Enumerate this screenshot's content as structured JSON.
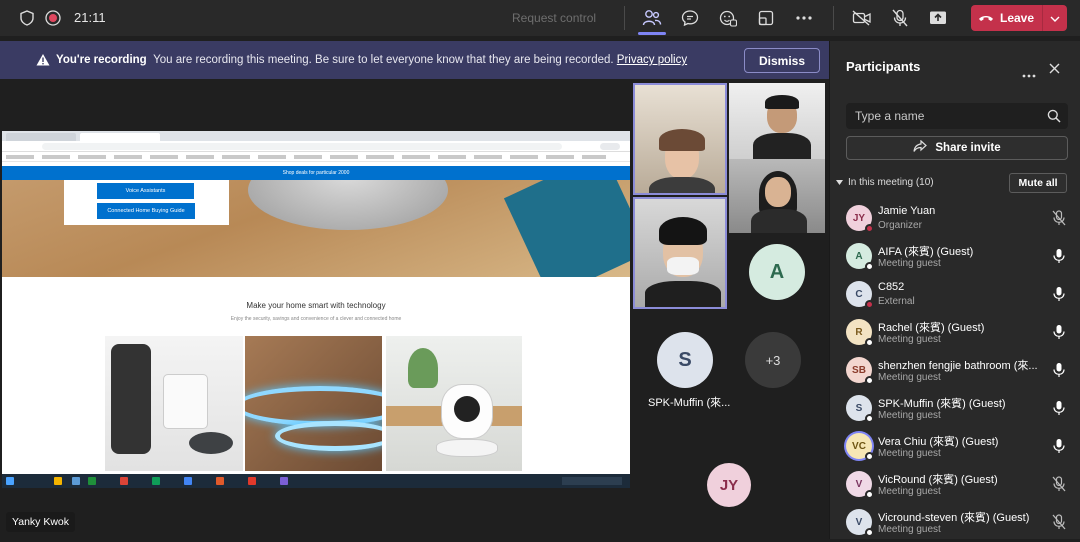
{
  "topbar": {
    "timer": "21:11",
    "request_control": "Request control",
    "leave_label": "Leave",
    "icons": [
      "shield-icon",
      "record-icon",
      "people-icon",
      "chat-icon",
      "reactions-icon",
      "rooms-icon",
      "more-icon",
      "camera-off-icon",
      "mic-off-icon",
      "share-icon",
      "phone-icon",
      "chevron-down-icon"
    ]
  },
  "banner": {
    "title": "You're recording",
    "message": "You are recording this meeting. Be sure to let everyone know that they are being recorded.",
    "link": "Privacy policy",
    "dismiss": "Dismiss"
  },
  "shared_screen": {
    "strip_text": "Shop deals for particular 2000",
    "buttons": [
      "Voice Assistants",
      "Connected Home Buying Guide"
    ],
    "headline": "Make your home smart with technology",
    "subline": "Enjoy the security, savings and convenience of a clever and connected home"
  },
  "tiles": {
    "a_initial": "A",
    "s_initial": "S",
    "s_name": "SPK-Muffin (來...",
    "more_count": "+3",
    "jy_initial": "JY"
  },
  "presenter_name": "Yanky Kwok",
  "panel": {
    "title": "Participants",
    "search_placeholder": "Type a name",
    "share_invite": "Share invite",
    "section": "In this meeting (10)",
    "mute_all": "Mute all",
    "participants": [
      {
        "initials": "JY",
        "name": "Jamie Yuan",
        "role": "Organizer",
        "avatar_bg": "#f0d0dc",
        "avatar_fg": "#8a2d4b",
        "status": "#c4314b",
        "mic": "muted"
      },
      {
        "initials": "A",
        "name": "AIFA (來賓) (Guest)",
        "role": "Meeting guest",
        "avatar_bg": "#d5ebe0",
        "avatar_fg": "#2d6a4f",
        "status": "#ffffff",
        "mic": "on"
      },
      {
        "initials": "C",
        "name": "C852",
        "role": "External",
        "avatar_bg": "#dde3ec",
        "avatar_fg": "#3a4a66",
        "status": "#c4314b",
        "mic": "on"
      },
      {
        "initials": "R",
        "name": "Rachel (來賓) (Guest)",
        "role": "Meeting guest",
        "avatar_bg": "#f3e3c3",
        "avatar_fg": "#7a5a1e",
        "status": "#ffffff",
        "mic": "on"
      },
      {
        "initials": "SB",
        "name": "shenzhen fengjie bathroom (來...",
        "role": "Meeting guest",
        "avatar_bg": "#f3d6cf",
        "avatar_fg": "#8a3a2a",
        "status": "#ffffff",
        "mic": "on"
      },
      {
        "initials": "S",
        "name": "SPK-Muffin (來賓) (Guest)",
        "role": "Meeting guest",
        "avatar_bg": "#dde3ec",
        "avatar_fg": "#3a4a66",
        "status": "#ffffff",
        "mic": "on"
      },
      {
        "initials": "VC",
        "name": "Vera Chiu (來賓) (Guest)",
        "role": "Meeting guest",
        "avatar_bg": "#f6e6b5",
        "avatar_fg": "#6e5413",
        "status": "#ffffff",
        "mic": "on",
        "speaking": true
      },
      {
        "initials": "V",
        "name": "VicRound (來賓) (Guest)",
        "role": "Meeting guest",
        "avatar_bg": "#f0d9e6",
        "avatar_fg": "#7a3560",
        "status": "#ffffff",
        "mic": "muted"
      },
      {
        "initials": "V",
        "name": "Vicround-steven (來賓) (Guest)",
        "role": "Meeting guest",
        "avatar_bg": "#dde3ec",
        "avatar_fg": "#3a4a66",
        "status": "#ffffff",
        "mic": "muted"
      }
    ]
  },
  "colors": {
    "accent": "#7f85f5",
    "leave": "#c4314b",
    "banner_bg": "#3a3b63"
  }
}
